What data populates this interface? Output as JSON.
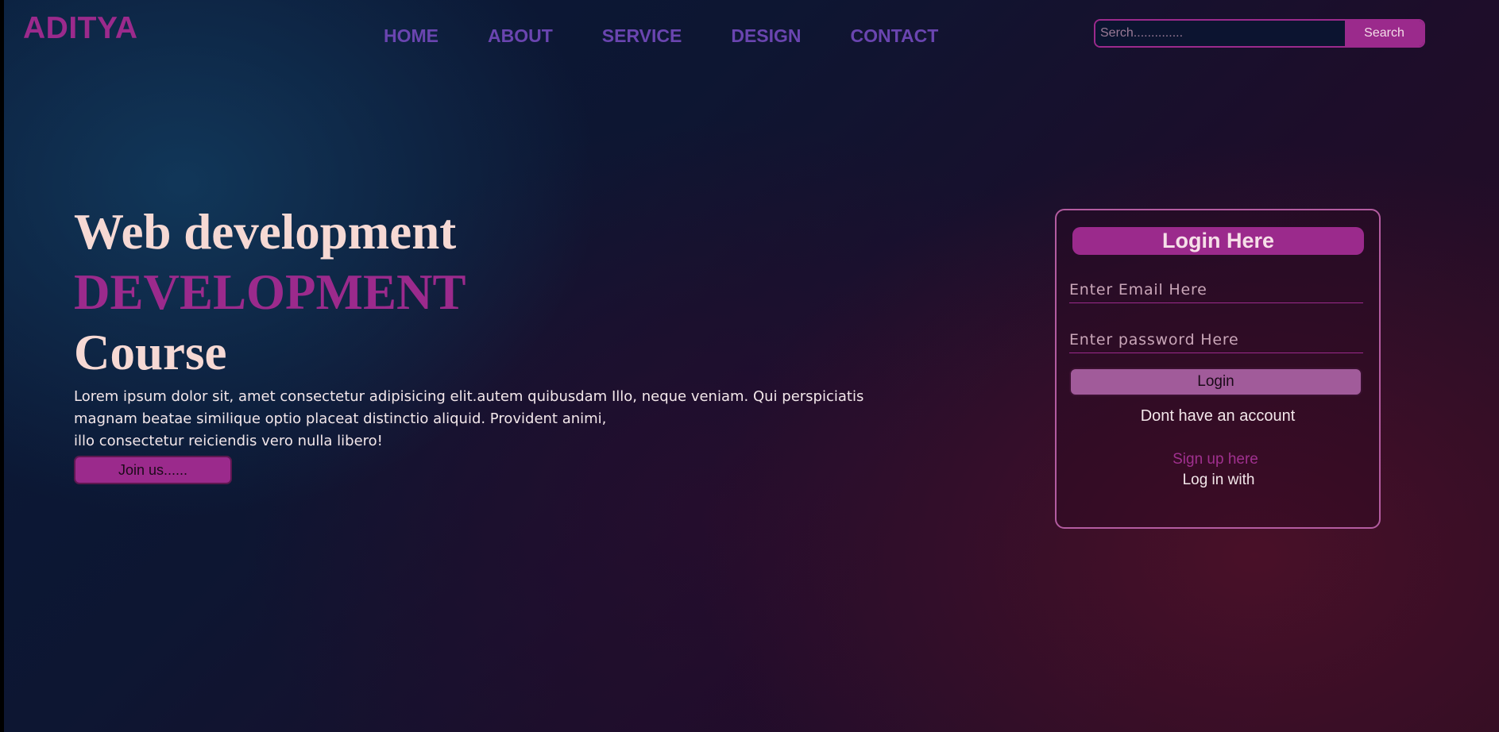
{
  "header": {
    "logo": "ADITYA",
    "nav": [
      {
        "label": "HOME"
      },
      {
        "label": "ABOUT"
      },
      {
        "label": "SERVICE"
      },
      {
        "label": "DESIGN"
      },
      {
        "label": "CONTACT"
      }
    ],
    "search": {
      "placeholder": "Serch..............",
      "button_label": "Search"
    }
  },
  "hero": {
    "line1": "Web development",
    "line2": "DEVELOPMENT",
    "line3": "Course",
    "paragraph_line1": "Lorem ipsum dolor sit, amet consectetur adipisicing elit.autem quibusdam Illo, neque veniam. Qui perspiciatis",
    "paragraph_line2": "magnam beatae similique optio placeat distinctio aliquid. Provident animi,",
    "paragraph_line3": "illo consectetur reiciendis vero nulla libero!",
    "join_label": "Join us......"
  },
  "login": {
    "title": "Login Here",
    "email_placeholder": "Enter Email Here",
    "password_placeholder": "Enter password Here",
    "button_label": "Login",
    "no_account_text": "Dont have an account",
    "signup_label": "Sign up here",
    "login_with_text": "Log in with"
  },
  "colors": {
    "accent": "#9b2a8c",
    "nav": "#6a45b0",
    "hero_text": "#f6d9d4"
  }
}
